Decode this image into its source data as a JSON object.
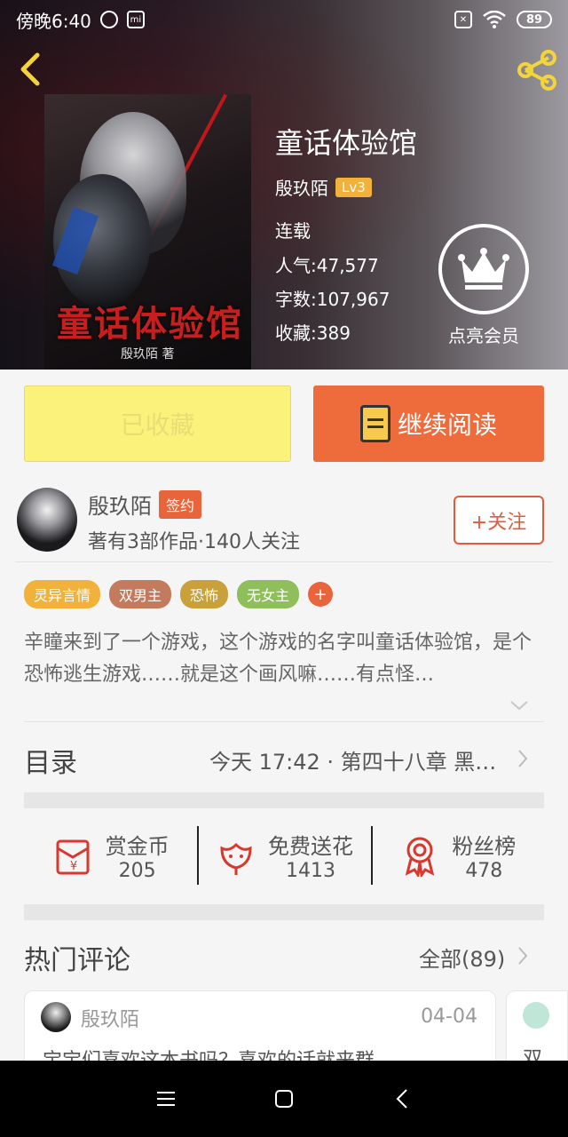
{
  "status_bar": {
    "time": "傍晚6:40",
    "battery": "89"
  },
  "book": {
    "title": "童话体验馆",
    "author": "殷玖陌",
    "level": "Lv3",
    "status": "连载",
    "popularity_label": "人气:",
    "popularity": "47,577",
    "word_count_label": "字数:",
    "word_count": "107,967",
    "favorites_label": "收藏:",
    "favorites": "389",
    "cover_title": "童话体验馆",
    "cover_author": "殷玖陌 著"
  },
  "vip": {
    "label": "点亮会员"
  },
  "actions": {
    "collected_label": "已收藏",
    "read_label": "继续阅读"
  },
  "author_card": {
    "name": "殷玖陌",
    "badge": "签约",
    "subtitle": "著有3部作品·140人关注",
    "follow_label": "+关注"
  },
  "tags": [
    {
      "label": "灵异言情",
      "color": "#f0b23a"
    },
    {
      "label": "双男主",
      "color": "#c47a5c"
    },
    {
      "label": "恐怖",
      "color": "#c9a03a"
    },
    {
      "label": "无女主",
      "color": "#8fbf5a"
    }
  ],
  "tag_more": "+",
  "synopsis": "辛瞳来到了一个游戏，这个游戏的名字叫童话体验馆，是个恐怖逃生游戏……就是这个画风嘛……有点怪…",
  "toc": {
    "label": "目录",
    "latest": "今天 17:42 · 第四十八章 黑…"
  },
  "rewards": [
    {
      "label": "赏金币",
      "count": "205",
      "icon": "red-envelope-icon"
    },
    {
      "label": "免费送花",
      "count": "1413",
      "icon": "flower-icon"
    },
    {
      "label": "粉丝榜",
      "count": "478",
      "icon": "medal-icon"
    }
  ],
  "hot_comments": {
    "label": "热门评论",
    "all_label": "全部(89)",
    "items": [
      {
        "user": "殷玖陌",
        "date": "04-04",
        "text": "宝宝们喜欢这本书吗？喜欢的话就来群"
      },
      {
        "text": "双"
      }
    ]
  },
  "colors": {
    "accent": "#ee6b3b",
    "collected_bg": "#fbf27b",
    "level_badge": "#f0b23a"
  }
}
